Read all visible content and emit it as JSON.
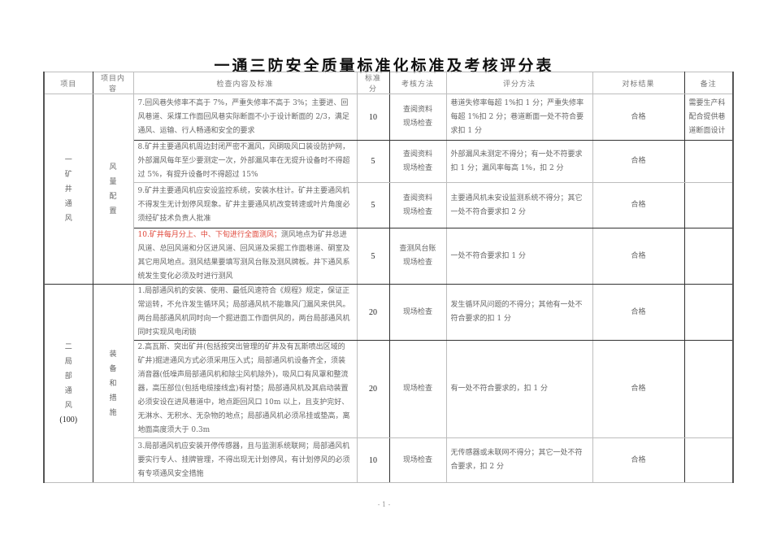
{
  "title": "一通三防安全质量标准化标准及考核评分表",
  "headers": {
    "item": "项目",
    "item_content": "项目内容",
    "check_content": "检查内容及标准",
    "standard_score": "标准分",
    "assessment_method": "考核方法",
    "scoring_method": "评分方法",
    "result": "对标结果",
    "remarks": "备注"
  },
  "sections": [
    {
      "item_label": [
        "一",
        "矿",
        "井",
        "通",
        "风"
      ],
      "content_label": [
        "风",
        "量",
        "配",
        "置"
      ],
      "rows": [
        {
          "check": "7.回风巷失修率不高于 7%，严重失修率不高于 3%；主要进、回风巷道、采煤工作面回风巷实际断面不小于设计断面的 2/3，满足通风、运输、行人畅通和安全的要求",
          "score": "10",
          "method": [
            "查阅资料",
            "现场检查"
          ],
          "scoring": "巷道失修率每超 1%扣 1 分；严重失修率每超 1%扣 2 分；巷道断面一处不符合要求扣 1 分",
          "result": "合格",
          "remarks": "需要生产科配合提供巷道断面设计"
        },
        {
          "check": "8.矿井主要通风机周边封闭严密不漏风，风硐吸风口装设防护网，外部漏风每年至少要测定一次，外部漏风率在无提升设备时不得超过 5%，有提升设备时不得超过 15%",
          "score": "5",
          "method": [
            "查阅资料",
            "现场检查"
          ],
          "scoring": "外部漏风未测定不得分；有一处不符要求扣 1 分；漏风率每高 1%，扣 2 分",
          "result": "合格",
          "remarks": ""
        },
        {
          "check": "9.矿井主要通风机应安设监控系统，安装水柱计。矿井主要通风机不得发生无计划停风现象。矿井主要通风机改变转速或叶片角度必须经矿技术负责人批准",
          "score": "5",
          "method": [
            "查阅资料",
            "现场检查"
          ],
          "scoring": "主要通风机未安设监测系统不得分；其它一处不符合要求扣 2 分",
          "result": "合格",
          "remarks": ""
        },
        {
          "check_prefix": "10.",
          "check_red": "矿井每月分上、中、下旬进行全面测风；",
          "check": "测风地点为矿井总进风道、总回风道和分区进风道、回风道及采掘工作面巷道、硐室及其它用风地点。测风结果要填写测风台账及测风牌板。井下通风系统发生变化必须及时进行测风",
          "score": "5",
          "method": [
            "查测风台账",
            "现场检查"
          ],
          "scoring": "一处不符合要求扣 1 分",
          "result": "合格",
          "remarks": ""
        }
      ]
    },
    {
      "item_label": [
        "二",
        "局",
        "部",
        "通",
        "风",
        "(100)"
      ],
      "content_label": [
        "装",
        "备",
        "和",
        "措",
        "施"
      ],
      "rows": [
        {
          "check": "1.局部通风机的安装、使用、最低风速符合《规程》规定，保证正常运转，不允许发生循环风；局部通风机不能靠风门漏风来供风。两台局部通风机同时向一个掘进面工作面供风的，两台局部通风机同时实现风电闭锁",
          "score": "20",
          "method": [
            "现场检查"
          ],
          "scoring": "发生循环风问题的不得分；其他有一处不符合要求的扣 1 分",
          "result": "合格",
          "remarks": ""
        },
        {
          "check": "2.高瓦斯、突出矿井(包括按突出管理的矿井及有瓦斯喷出区域的矿井)掘进通风方式必须采用压入式；局部通风机设备齐全，须装消音器(低噪声局部通风机和除尘风机除外)，吸风口有风罩和整流器，高压部位(包括电缆接线盒)有衬垫；局部通风机及其启动装置必须安设在进风巷道中，地点距回风口 10m 以上，且支护完好、无淋水、无积水、无杂物的地点；局部通风机必须吊挂或垫高，离地面高度须大于 0.3m",
          "score": "20",
          "method": [
            "现场检查"
          ],
          "scoring": "有一处不符合要求的，扣 1 分",
          "result": "合格",
          "remarks": ""
        },
        {
          "check": "3.局部通风机应安装开停传感器，且与监测系统联网；局部通风机要实行专人、挂牌管理，不得出现无计划停风，有计划停风的必须有专项通风安全措施",
          "score": "10",
          "method": [
            "现场检查"
          ],
          "scoring": "无传感器或未联网不得分；其它一处不符合要求，扣 2 分",
          "result": "合格",
          "remarks": ""
        }
      ]
    }
  ],
  "page_number": "- 1 -",
  "colors": {
    "highlight_red": "#e0473a"
  }
}
